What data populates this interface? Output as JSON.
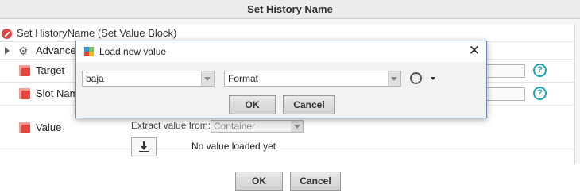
{
  "dialog": {
    "title": "Set  History Name",
    "header": "Set HistoryName  (Set Value Block)",
    "properties": {
      "advanced": "Advance",
      "target": "Target",
      "slot_name": "Slot Nam",
      "value": "Value"
    },
    "help_glyph": "?",
    "extract_label": "Extract value from:",
    "extract_value": "Container",
    "no_value_text": "No value loaded yet",
    "ok_label": "OK",
    "cancel_label": "Cancel"
  },
  "modal": {
    "title": "Load new value",
    "close_glyph": "✕",
    "module_select": "baja",
    "type_select": "Format",
    "ok_label": "OK",
    "cancel_label": "Cancel"
  },
  "colors": {
    "accent": "#1aa3b5",
    "error": "#e04545",
    "modal_border": "#6f8db4"
  },
  "icons": [
    "error-icon",
    "expand-icon",
    "gear-icon",
    "component-icon",
    "help-icon",
    "download-icon",
    "app-icon",
    "close-icon",
    "clock-icon",
    "caret-down-icon"
  ]
}
